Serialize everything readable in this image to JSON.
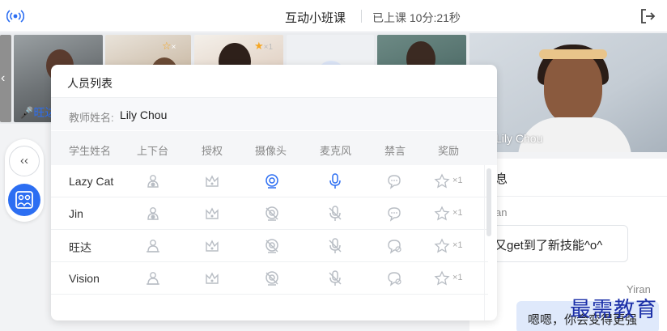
{
  "topbar": {
    "title": "互动小班课",
    "status": "已上课 10分:21秒"
  },
  "strip": {
    "thumbs": [
      {
        "name": "旺达"
      },
      {
        "star_count": "×"
      },
      {
        "star_count": "×1"
      }
    ]
  },
  "bigvideo": {
    "name": "Lily Chou"
  },
  "popup": {
    "title": "人员列表",
    "teacher_label": "教师姓名:",
    "teacher_name": "Lily Chou",
    "columns": [
      "学生姓名",
      "上下台",
      "授权",
      "摄像头",
      "麦克风",
      "禁言",
      "奖励"
    ],
    "students": [
      {
        "name": "Lazy Cat",
        "reward": "×1",
        "cam_on": true,
        "mic_on": true
      },
      {
        "name": "Jin",
        "reward": "×1",
        "cam_on": false,
        "mic_on": false
      },
      {
        "name": "旺达",
        "reward": "×1",
        "cam_on": false,
        "mic_on": false
      },
      {
        "name": "Vision",
        "reward": "×1",
        "cam_on": false,
        "mic_on": false
      }
    ]
  },
  "chat": {
    "title": "息",
    "sender1": "an",
    "message1": "又get到了新技能^o^",
    "sender2": "Yiran",
    "message2": "嗯嗯，你会变得更强"
  },
  "watermark": "最需教育",
  "colors": {
    "accent": "#2c6ef2",
    "star": "#f5a623",
    "icon_gray": "#b8bdc4"
  }
}
